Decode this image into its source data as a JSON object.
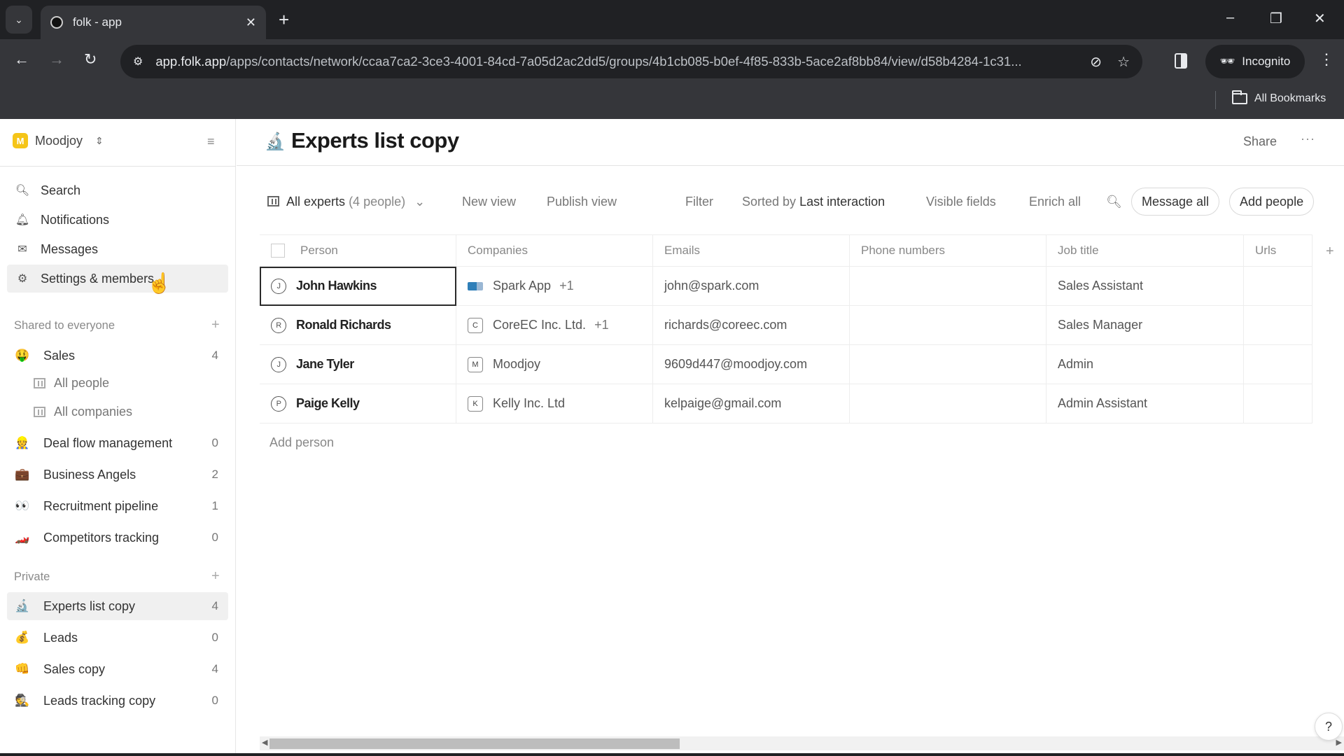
{
  "browser": {
    "tab_title": "folk - app",
    "url_host": "app.folk.app",
    "url_path": "/apps/contacts/network/ccaa7ca2-3ce3-4001-84cd-7a05d2ac2dd5/groups/4b1cb085-b0ef-4f85-833b-5ace2af8bb84/view/d58b4284-1c31...",
    "profile_label": "Incognito",
    "bookmarks_label": "All Bookmarks"
  },
  "sidebar": {
    "workspace_initial": "M",
    "workspace_name": "Moodjoy",
    "nav": [
      {
        "label": "Search",
        "icon": "search-icon"
      },
      {
        "label": "Notifications",
        "icon": "bell-icon"
      },
      {
        "label": "Messages",
        "icon": "mail-icon"
      },
      {
        "label": "Settings & members",
        "icon": "gear-icon"
      }
    ],
    "shared_label": "Shared to everyone",
    "shared_groups": [
      {
        "emoji": "🤑",
        "label": "Sales",
        "count": "4"
      },
      {
        "emoji": "👷",
        "label": "Deal flow management",
        "count": "0"
      },
      {
        "emoji": "💼",
        "label": "Business Angels",
        "count": "2"
      },
      {
        "emoji": "👀",
        "label": "Recruitment pipeline",
        "count": "1"
      },
      {
        "emoji": "🏎️",
        "label": "Competitors tracking",
        "count": "0"
      }
    ],
    "sales_views": [
      "All people",
      "All companies"
    ],
    "private_label": "Private",
    "private_groups": [
      {
        "emoji": "🔬",
        "label": "Experts list copy",
        "count": "4"
      },
      {
        "emoji": "💰",
        "label": "Leads",
        "count": "0"
      },
      {
        "emoji": "👊",
        "label": "Sales copy",
        "count": "4"
      },
      {
        "emoji": "🕵️",
        "label": "Leads tracking copy",
        "count": "0"
      }
    ]
  },
  "header": {
    "icon": "microscope-icon",
    "title": "Experts list copy",
    "share_label": "Share",
    "more_label": "···"
  },
  "toolbar": {
    "view_name": "All experts",
    "view_count": "(4 people)",
    "new_view": "New view",
    "publish_view": "Publish view",
    "filter": "Filter",
    "sorted_prefix": "Sorted by",
    "sorted_value": "Last interaction",
    "visible_fields": "Visible fields",
    "enrich_all": "Enrich all",
    "message_all": "Message all",
    "add_people": "Add people"
  },
  "table": {
    "columns": [
      "Person",
      "Companies",
      "Emails",
      "Phone numbers",
      "Job title",
      "Urls"
    ],
    "rows": [
      {
        "initial": "J",
        "person": "John Hawkins",
        "company_logo": "",
        "company": "Spark App",
        "company_more": "+1",
        "email": "john@spark.com",
        "phone": "",
        "job": "Sales Assistant",
        "urls": ""
      },
      {
        "initial": "R",
        "person": "Ronald Richards",
        "company_logo": "C",
        "company": "CoreEC Inc. Ltd.",
        "company_more": "+1",
        "email": "richards@coreec.com",
        "phone": "",
        "job": "Sales Manager",
        "urls": ""
      },
      {
        "initial": "J",
        "person": "Jane Tyler",
        "company_logo": "M",
        "company": "Moodjoy",
        "company_more": "",
        "email": "9609d447@moodjoy.com",
        "phone": "",
        "job": "Admin",
        "urls": ""
      },
      {
        "initial": "P",
        "person": "Paige Kelly",
        "company_logo": "K",
        "company": "Kelly Inc. Ltd",
        "company_more": "",
        "email": "kelpaige@gmail.com",
        "phone": "",
        "job": "Admin Assistant",
        "urls": ""
      }
    ],
    "add_person_label": "Add person",
    "add_column_label": "+"
  },
  "help_label": "?"
}
